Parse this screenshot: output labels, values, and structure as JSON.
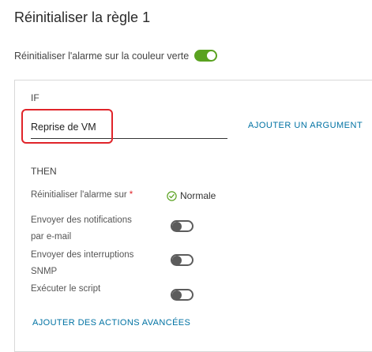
{
  "header": {
    "title": "Réinitialiser la règle 1"
  },
  "reset_alarm": {
    "label": "Réinitialiser l'alarme sur la couleur verte",
    "enabled": true
  },
  "condition": {
    "if_label": "IF",
    "value": "Reprise de VM",
    "add_argument_label": "AJOUTER UN ARGUMENT"
  },
  "actions": {
    "then_label": "THEN",
    "reset_alarm_on": {
      "label": "Réinitialiser l'alarme sur",
      "required_marker": "*",
      "status_icon": "check-circle-icon",
      "status": "Normale"
    },
    "email_notifications": {
      "label_line1": "Envoyer des notifications",
      "label_line2": "par e-mail",
      "enabled": false
    },
    "snmp_traps": {
      "label_line1": "Envoyer des interruptions",
      "label_line2": "SNMP",
      "enabled": false
    },
    "run_script": {
      "label": "Exécuter le script",
      "enabled": false
    },
    "advanced_actions_label": "AJOUTER DES ACTIONS AVANCÉES"
  },
  "colors": {
    "toggle_on": "#5aa220",
    "toggle_off": "#5c5c5c",
    "link": "#0072a3",
    "highlight": "#e0242a",
    "status_ok": "#5aa220"
  }
}
